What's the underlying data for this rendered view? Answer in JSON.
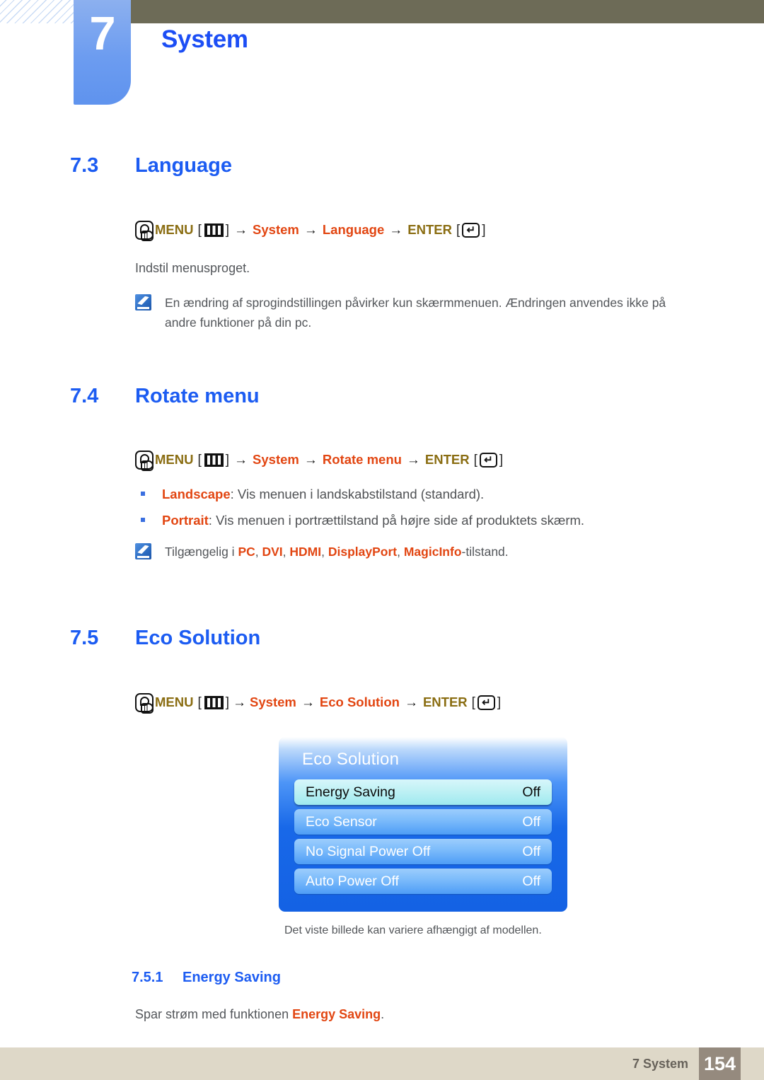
{
  "header": {
    "chapter_number": "7",
    "chapter_title": "System"
  },
  "sections": [
    {
      "number": "7.3",
      "title": "Language",
      "path": {
        "menu_label": "MENU",
        "menu_key_icon": "menu-bars-icon",
        "steps": [
          "System",
          "Language"
        ],
        "enter_label": "ENTER",
        "enter_key_icon": "enter-key-icon",
        "arrow": "→",
        "bracket_open": "[",
        "bracket_close": "]"
      },
      "intro": "Indstil menusproget.",
      "note": "En ændring af sprogindstillingen påvirker kun skærmmenuen. Ændringen anvendes ikke på andre funktioner på din pc."
    },
    {
      "number": "7.4",
      "title": "Rotate menu",
      "path": {
        "menu_label": "MENU",
        "steps": [
          "System",
          "Rotate menu"
        ],
        "enter_label": "ENTER"
      },
      "bullets": [
        {
          "term": "Landscape",
          "text": ": Vis menuen i landskabstilstand (standard)."
        },
        {
          "term": "Portrait",
          "text": ": Vis menuen i portrættilstand på højre side af produktets skærm."
        }
      ],
      "note_parts": {
        "prefix": "Tilgængelig i ",
        "modes": [
          "PC",
          "DVI",
          "HDMI",
          "DisplayPort",
          "MagicInfo"
        ],
        "suffix": "-tilstand.",
        "separator": ", "
      }
    },
    {
      "number": "7.5",
      "title": "Eco Solution",
      "path": {
        "menu_label": "MENU",
        "steps": [
          "System",
          "Eco Solution"
        ],
        "enter_label": "ENTER"
      },
      "caption": "Det viste billede kan variere afhængigt af modellen.",
      "subsection": {
        "number": "7.5.1",
        "title": "Energy Saving",
        "body_prefix": "Spar strøm med funktionen ",
        "body_highlight": "Energy Saving",
        "body_suffix": "."
      }
    }
  ],
  "osd": {
    "title": "Eco Solution",
    "rows": [
      {
        "label": "Energy Saving",
        "value": "Off",
        "selected": true
      },
      {
        "label": "Eco Sensor",
        "value": "Off",
        "selected": false
      },
      {
        "label": "No Signal Power Off",
        "value": "Off",
        "selected": false
      },
      {
        "label": "Auto Power Off",
        "value": "Off",
        "selected": false
      }
    ]
  },
  "footer": {
    "label": "7 System",
    "page": "154"
  },
  "colors": {
    "heading_blue": "#1c5cf2",
    "chapter_tab_blue": "#6c9cf0",
    "olive_bar": "#6d6b57",
    "accent_orange": "#e24612",
    "accent_olive_text": "#8a6d12",
    "footer_bar": "#ded8c8",
    "footer_page_box": "#958a7e",
    "osd_blue": "#1868e8",
    "osd_selected": "#c3f2f5"
  }
}
